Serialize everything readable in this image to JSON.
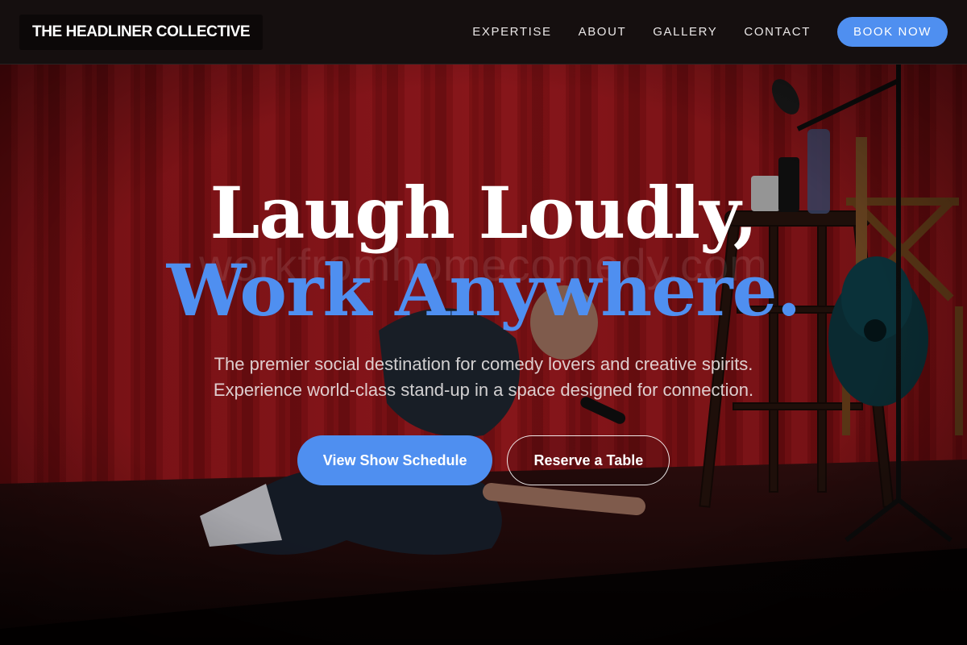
{
  "header": {
    "brand": "THE HEADLINER COLLECTIVE",
    "nav": [
      "EXPERTISE",
      "ABOUT",
      "GALLERY",
      "CONTACT"
    ],
    "cta": "BOOK NOW"
  },
  "hero": {
    "line1": "Laugh Loudly,",
    "line2": "Work Anywhere.",
    "watermark": "workfromhomecomedy.com",
    "sub1": "The premier social destination for comedy lovers and creative spirits.",
    "sub2": "Experience world-class stand-up in a space designed for connection.",
    "primary_button": "View Show Schedule",
    "secondary_button": "Reserve a Table"
  },
  "colors": {
    "accent": "#4f8ff0",
    "curtain": "#a8151b",
    "header_bg": "#150f0f"
  }
}
